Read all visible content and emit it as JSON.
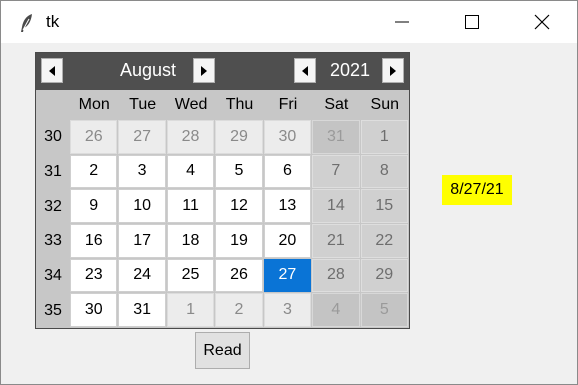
{
  "window": {
    "title": "tk"
  },
  "calendar": {
    "month": "August",
    "year": "2021",
    "weekdays": [
      "Mon",
      "Tue",
      "Wed",
      "Thu",
      "Fri",
      "Sat",
      "Sun"
    ],
    "weeks": [
      {
        "num": "30",
        "days": [
          {
            "d": "26",
            "t": "other"
          },
          {
            "d": "27",
            "t": "other"
          },
          {
            "d": "28",
            "t": "other"
          },
          {
            "d": "29",
            "t": "other"
          },
          {
            "d": "30",
            "t": "other"
          },
          {
            "d": "31",
            "t": "other-weekend"
          },
          {
            "d": "1",
            "t": "weekend"
          }
        ]
      },
      {
        "num": "31",
        "days": [
          {
            "d": "2",
            "t": "normal"
          },
          {
            "d": "3",
            "t": "normal"
          },
          {
            "d": "4",
            "t": "normal"
          },
          {
            "d": "5",
            "t": "normal"
          },
          {
            "d": "6",
            "t": "normal"
          },
          {
            "d": "7",
            "t": "weekend"
          },
          {
            "d": "8",
            "t": "weekend"
          }
        ]
      },
      {
        "num": "32",
        "days": [
          {
            "d": "9",
            "t": "normal"
          },
          {
            "d": "10",
            "t": "normal"
          },
          {
            "d": "11",
            "t": "normal"
          },
          {
            "d": "12",
            "t": "normal"
          },
          {
            "d": "13",
            "t": "normal"
          },
          {
            "d": "14",
            "t": "weekend"
          },
          {
            "d": "15",
            "t": "weekend"
          }
        ]
      },
      {
        "num": "33",
        "days": [
          {
            "d": "16",
            "t": "normal"
          },
          {
            "d": "17",
            "t": "normal"
          },
          {
            "d": "18",
            "t": "normal"
          },
          {
            "d": "19",
            "t": "normal"
          },
          {
            "d": "20",
            "t": "normal"
          },
          {
            "d": "21",
            "t": "weekend"
          },
          {
            "d": "22",
            "t": "weekend"
          }
        ]
      },
      {
        "num": "34",
        "days": [
          {
            "d": "23",
            "t": "normal"
          },
          {
            "d": "24",
            "t": "normal"
          },
          {
            "d": "25",
            "t": "normal"
          },
          {
            "d": "26",
            "t": "normal"
          },
          {
            "d": "27",
            "t": "selected"
          },
          {
            "d": "28",
            "t": "weekend"
          },
          {
            "d": "29",
            "t": "weekend"
          }
        ]
      },
      {
        "num": "35",
        "days": [
          {
            "d": "30",
            "t": "normal"
          },
          {
            "d": "31",
            "t": "normal"
          },
          {
            "d": "1",
            "t": "other"
          },
          {
            "d": "2",
            "t": "other"
          },
          {
            "d": "3",
            "t": "other"
          },
          {
            "d": "4",
            "t": "other-weekend"
          },
          {
            "d": "5",
            "t": "other-weekend"
          }
        ]
      }
    ]
  },
  "selected_date_label": "8/27/21",
  "read_button_label": "Read",
  "colors": {
    "header_bg": "#4f4f4f",
    "selected_day": "#0a74d6",
    "date_label_bg": "#ffff00"
  },
  "icons": [
    "feather-icon",
    "minimize-icon",
    "maximize-icon",
    "close-icon",
    "arrow-left-icon",
    "arrow-right-icon"
  ]
}
